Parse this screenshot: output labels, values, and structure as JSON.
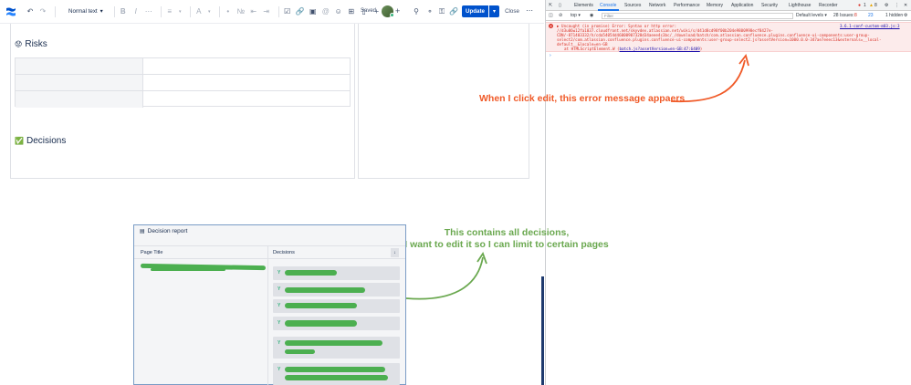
{
  "toolbar": {
    "text_style": "Normal text",
    "saved": "Saved",
    "update_label": "Update",
    "close_label": "Close"
  },
  "content": {
    "risks_heading": "Risks",
    "decisions_heading": "Decisions"
  },
  "devtools": {
    "tabs": [
      "Elements",
      "Console",
      "Sources",
      "Network",
      "Performance",
      "Memory",
      "Application",
      "Security",
      "Lighthouse",
      "Recorder"
    ],
    "active_tab": "Console",
    "context": "top",
    "filter_placeholder": "Filter",
    "levels": "Default levels",
    "issues": "28 Issues:",
    "issues_error": "8",
    "issues_warn": "23",
    "hidden": "1 hidden",
    "error_count": "1",
    "warn_count": "8",
    "error_lines": [
      "▶ Uncaught (in promise) Error: Syntax or http error:",
      "//d3u06w12fa1037.cloudfront.net/skyvdev.atlassian.net/wiki/s/d41d8cd98f00b204e9800998ecf8427e-",
      "CDN/-871403332/h/cda54054d46000907328d34aeee4c3bc/_/download/batch/com.atlassian.confluence.plugins.confluence-ui-components:user-group-",
      "select2/com.atlassian.confluence.plugins.confluence-ui-components:user-group-select2.js?assetVersion=1000.0.0-347ae7eeec13&externals=__local-",
      "default__&locale=en-GB"
    ],
    "error_at": "at HTMLScriptElement.W",
    "error_at_link": "batch.js?assetVersion=en-GB:47:6409",
    "error_source": "3.6.1-conf-custom-m03.js:3"
  },
  "annotations": {
    "red": "When I click edit, this error message appaers",
    "green_line1": "This contains all decisions,",
    "green_line2": "I want to edit it so I can limit to certain pages"
  },
  "report": {
    "title": "Decision report",
    "col_page": "Page Title",
    "col_decisions": "Decisions"
  },
  "colors": {
    "primary": "#0052cc",
    "annotation_red": "#f05a28",
    "annotation_green": "#6aa84f",
    "error_red": "#d93025"
  }
}
